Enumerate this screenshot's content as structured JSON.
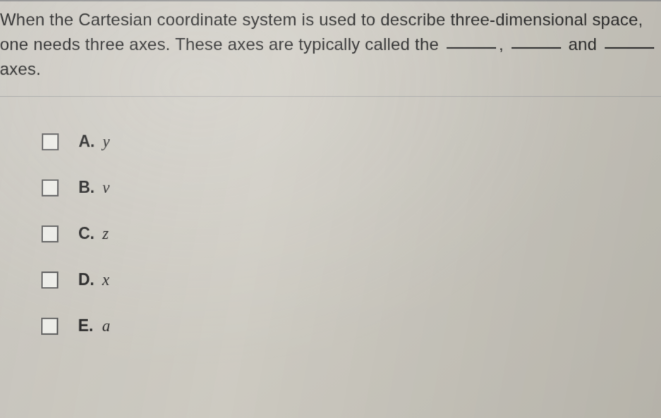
{
  "question": {
    "text_part1": "When the Cartesian coordinate system is used to describe three-dimensional space, one needs three axes. These axes are typically called the ",
    "text_part2": ", ",
    "text_part3": " and ",
    "text_part4": " axes."
  },
  "options": [
    {
      "letter": "A.",
      "value": "y"
    },
    {
      "letter": "B.",
      "value": "v"
    },
    {
      "letter": "C.",
      "value": "z"
    },
    {
      "letter": "D.",
      "value": "x"
    },
    {
      "letter": "E.",
      "value": "a"
    }
  ]
}
